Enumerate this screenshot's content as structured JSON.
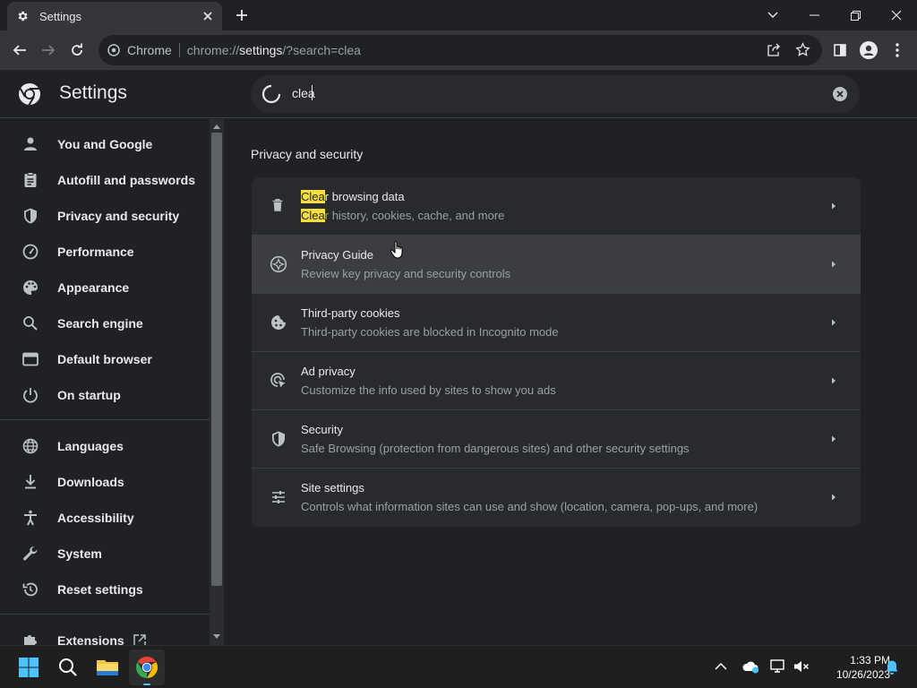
{
  "tab": {
    "title": "Settings"
  },
  "omnibox": {
    "site_label": "Chrome",
    "url_scheme": "chrome://",
    "url_host": "settings",
    "url_rest": "/?search=clea"
  },
  "header": {
    "title": "Settings",
    "search_value": "clea"
  },
  "sidebar": {
    "items": [
      {
        "label": "You and Google",
        "icon": "person-icon"
      },
      {
        "label": "Autofill and passwords",
        "icon": "clipboard-icon"
      },
      {
        "label": "Privacy and security",
        "icon": "shield-icon"
      },
      {
        "label": "Performance",
        "icon": "gauge-icon"
      },
      {
        "label": "Appearance",
        "icon": "palette-icon"
      },
      {
        "label": "Search engine",
        "icon": "search-icon"
      },
      {
        "label": "Default browser",
        "icon": "browser-icon"
      },
      {
        "label": "On startup",
        "icon": "power-icon"
      },
      {
        "label": "Languages",
        "icon": "globe-icon"
      },
      {
        "label": "Downloads",
        "icon": "download-icon"
      },
      {
        "label": "Accessibility",
        "icon": "accessibility-icon"
      },
      {
        "label": "System",
        "icon": "wrench-icon"
      },
      {
        "label": "Reset settings",
        "icon": "reset-icon"
      },
      {
        "label": "Extensions",
        "icon": "puzzle-icon"
      }
    ]
  },
  "main": {
    "section_title": "Privacy and security",
    "rows": [
      {
        "title_hl": "Clea",
        "title_rest": "r browsing data",
        "sub_hl": "Clea",
        "sub_rest": "r history, cookies, cache, and more",
        "icon": "trash-icon"
      },
      {
        "title": "Privacy Guide",
        "sub": "Review key privacy and security controls",
        "icon": "compass-icon"
      },
      {
        "title": "Third-party cookies",
        "sub": "Third-party cookies are blocked in Incognito mode",
        "icon": "cookie-icon"
      },
      {
        "title": "Ad privacy",
        "sub": "Customize the info used by sites to show you ads",
        "icon": "ad-privacy-icon"
      },
      {
        "title": "Security",
        "sub": "Safe Browsing (protection from dangerous sites) and other security settings",
        "icon": "shield-icon"
      },
      {
        "title": "Site settings",
        "sub": "Controls what information sites can use and show (location, camera, pop-ups, and more)",
        "icon": "sliders-icon"
      }
    ]
  },
  "taskbar": {
    "time": "1:33 PM",
    "date": "10/26/2023"
  },
  "colors": {
    "accent_highlight": "#f6df3f",
    "background": "#202124",
    "card": "#292a2d"
  }
}
